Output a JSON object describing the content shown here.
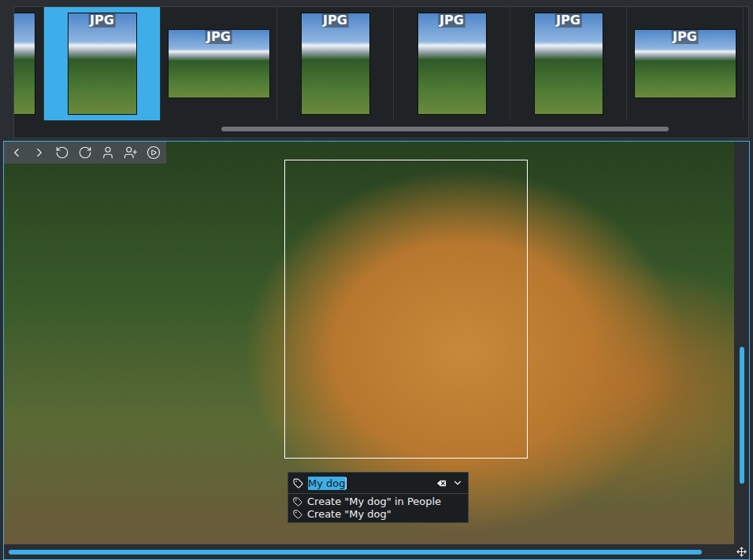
{
  "thumbnail_strip": {
    "items": [
      {
        "orientation": "portrait",
        "partial": true,
        "selected": false
      },
      {
        "badge": "JPG",
        "orientation": "portrait",
        "partial": false,
        "selected": true
      },
      {
        "badge": "JPG",
        "orientation": "landscape",
        "partial": false,
        "selected": false
      },
      {
        "badge": "JPG",
        "orientation": "portrait",
        "partial": false,
        "selected": false
      },
      {
        "badge": "JPG",
        "orientation": "portrait",
        "partial": false,
        "selected": false
      },
      {
        "badge": "JPG",
        "orientation": "portrait",
        "partial": false,
        "selected": false
      },
      {
        "badge": "JPG",
        "orientation": "landscape",
        "partial": false,
        "selected": false
      }
    ],
    "scrollbar": {
      "start": 0.28,
      "size": 0.615
    }
  },
  "viewer": {
    "face_region": {
      "tag_editor": {
        "value": "My dog",
        "text_selected": true
      },
      "suggestions": [
        {
          "label": "Create \"My dog\" in People"
        },
        {
          "label": "Create \"My dog\""
        }
      ]
    },
    "vertical_scrollbar": {
      "start": 0.51,
      "size": 0.34
    },
    "horizontal_scrollbar": {
      "start": 0.005,
      "size": 0.952
    }
  }
}
